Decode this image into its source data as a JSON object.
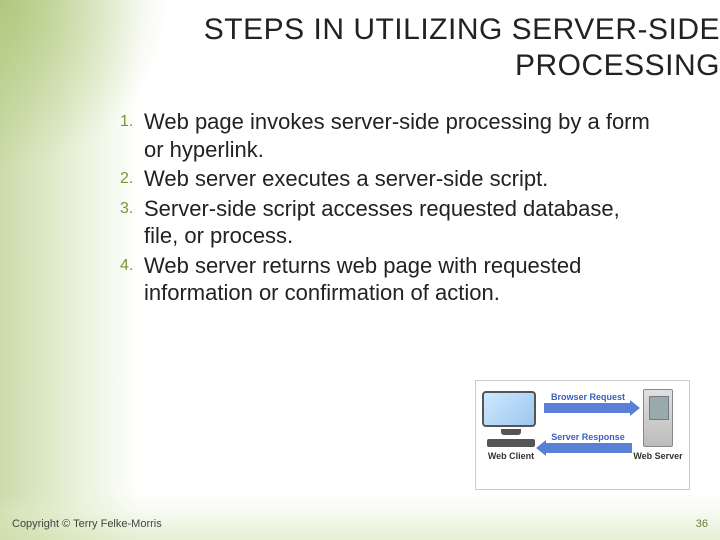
{
  "title": "STEPS IN UTILIZING SERVER-SIDE PROCESSING",
  "steps": [
    "Web page invokes server-side processing by a form or hyperlink.",
    "Web server executes a server-side script.",
    "Server-side script accesses requested database, file, or process.",
    "Web server returns web page with requested information or confirmation of action."
  ],
  "diagram": {
    "client_label": "Web Client",
    "server_label": "Web Server",
    "arrow_top": "Browser Request",
    "arrow_bottom": "Server Response"
  },
  "footer": "Copyright © Terry Felke-Morris",
  "page_number": "36"
}
